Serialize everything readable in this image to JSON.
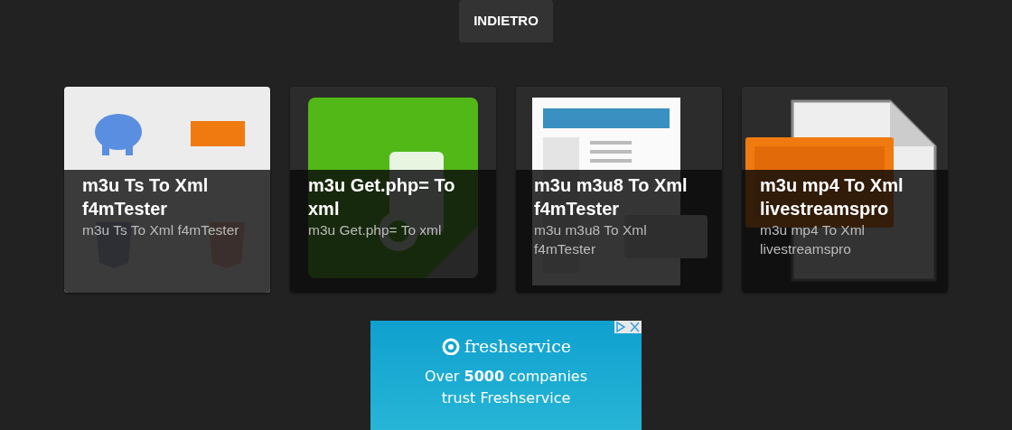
{
  "back_button": {
    "label": "INDIETRO"
  },
  "cards": [
    {
      "title": "m3u Ts To Xml f4mTester",
      "subtitle": "m3u Ts To Xml f4mTester",
      "kind": "picture"
    },
    {
      "title": "m3u Get.php= To xml",
      "subtitle": "m3u Get.php= To xml",
      "kind": "picture"
    },
    {
      "title": "m3u m3u8 To Xml f4mTester",
      "subtitle": "m3u m3u8 To Xml f4mTester",
      "kind": "picture"
    },
    {
      "title": "m3u mp4 To Xml livestreamspro",
      "subtitle": "m3u mp4 To Xml livestreamspro",
      "kind": "picture"
    }
  ],
  "ad": {
    "brand": "freshservice",
    "headline": "Over **5000** companies",
    "tagline": "trust Freshservice"
  }
}
